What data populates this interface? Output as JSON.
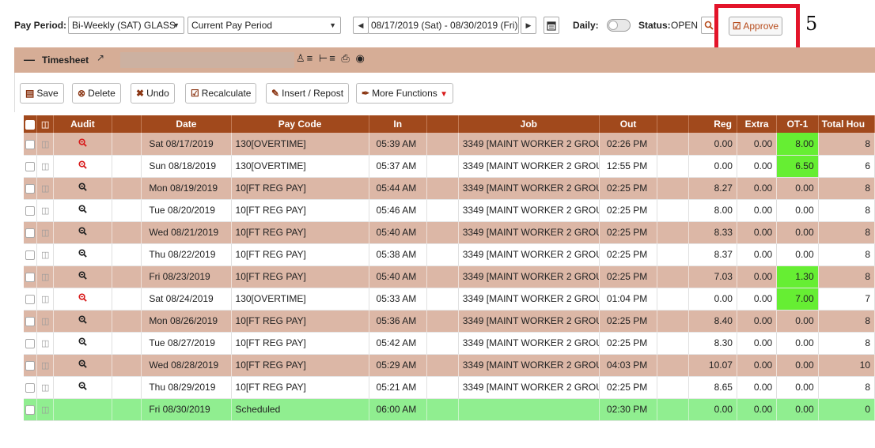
{
  "topbar": {
    "pay_period_label": "Pay Period:",
    "pay_period_value": "Bi-Weekly (SAT) GLASS",
    "period_select_value": "Current Pay Period",
    "date_range": "08/17/2019 (Sat) - 08/30/2019 (Fri)",
    "daily_label": "Daily:",
    "status_label": "Status:",
    "status_value": "OPEN",
    "approve_label": "Approve",
    "step_number": "5"
  },
  "timesheet": {
    "title": "Timesheet"
  },
  "toolbar": {
    "save": "Save",
    "delete": "Delete",
    "undo": "Undo",
    "recalculate": "Recalculate",
    "insert_repost": "Insert / Repost",
    "more_functions": "More Functions"
  },
  "table": {
    "headers": {
      "audit": "Audit",
      "date": "Date",
      "pay_code": "Pay Code",
      "in": "In",
      "job": "Job",
      "out": "Out",
      "reg": "Reg",
      "extra": "Extra",
      "ot1": "OT-1",
      "total_hours": "Total Hou"
    },
    "rows": [
      {
        "date": "Sat 08/17/2019",
        "pay_code": "130[OVERTIME]",
        "in": "05:39 AM",
        "job": "3349 [MAINT WORKER 2 GROU",
        "out": "02:26 PM",
        "reg": "0.00",
        "extra": "0.00",
        "ot1": "8.00",
        "total": "8"
      },
      {
        "date": "Sun 08/18/2019",
        "pay_code": "130[OVERTIME]",
        "in": "05:37 AM",
        "job": "3349 [MAINT WORKER 2 GROU",
        "out": "12:55 PM",
        "reg": "0.00",
        "extra": "0.00",
        "ot1": "6.50",
        "total": "6"
      },
      {
        "date": "Mon 08/19/2019",
        "pay_code": "10[FT REG PAY]",
        "in": "05:44 AM",
        "job": "3349 [MAINT WORKER 2 GROU",
        "out": "02:25 PM",
        "reg": "8.27",
        "extra": "0.00",
        "ot1": "0.00",
        "total": "8"
      },
      {
        "date": "Tue 08/20/2019",
        "pay_code": "10[FT REG PAY]",
        "in": "05:46 AM",
        "job": "3349 [MAINT WORKER 2 GROU",
        "out": "02:25 PM",
        "reg": "8.00",
        "extra": "0.00",
        "ot1": "0.00",
        "total": "8"
      },
      {
        "date": "Wed 08/21/2019",
        "pay_code": "10[FT REG PAY]",
        "in": "05:40 AM",
        "job": "3349 [MAINT WORKER 2 GROU",
        "out": "02:25 PM",
        "reg": "8.33",
        "extra": "0.00",
        "ot1": "0.00",
        "total": "8"
      },
      {
        "date": "Thu 08/22/2019",
        "pay_code": "10[FT REG PAY]",
        "in": "05:38 AM",
        "job": "3349 [MAINT WORKER 2 GROU",
        "out": "02:25 PM",
        "reg": "8.37",
        "extra": "0.00",
        "ot1": "0.00",
        "total": "8"
      },
      {
        "date": "Fri 08/23/2019",
        "pay_code": "10[FT REG PAY]",
        "in": "05:40 AM",
        "job": "3349 [MAINT WORKER 2 GROU",
        "out": "02:25 PM",
        "reg": "7.03",
        "extra": "0.00",
        "ot1": "1.30",
        "total": "8"
      },
      {
        "date": "Sat 08/24/2019",
        "pay_code": "130[OVERTIME]",
        "in": "05:33 AM",
        "job": "3349 [MAINT WORKER 2 GROU",
        "out": "01:04 PM",
        "reg": "0.00",
        "extra": "0.00",
        "ot1": "7.00",
        "total": "7"
      },
      {
        "date": "Mon 08/26/2019",
        "pay_code": "10[FT REG PAY]",
        "in": "05:36 AM",
        "job": "3349 [MAINT WORKER 2 GROU",
        "out": "02:25 PM",
        "reg": "8.40",
        "extra": "0.00",
        "ot1": "0.00",
        "total": "8"
      },
      {
        "date": "Tue 08/27/2019",
        "pay_code": "10[FT REG PAY]",
        "in": "05:42 AM",
        "job": "3349 [MAINT WORKER 2 GROU",
        "out": "02:25 PM",
        "reg": "8.30",
        "extra": "0.00",
        "ot1": "0.00",
        "total": "8"
      },
      {
        "date": "Wed 08/28/2019",
        "pay_code": "10[FT REG PAY]",
        "in": "05:29 AM",
        "job": "3349 [MAINT WORKER 2 GROU",
        "out": "04:03 PM",
        "reg": "10.07",
        "extra": "0.00",
        "ot1": "0.00",
        "total": "10"
      },
      {
        "date": "Thu 08/29/2019",
        "pay_code": "10[FT REG PAY]",
        "in": "05:21 AM",
        "job": "3349 [MAINT WORKER 2 GROU",
        "out": "02:25 PM",
        "reg": "8.65",
        "extra": "0.00",
        "ot1": "0.00",
        "total": "8"
      },
      {
        "date": "Fri 08/30/2019",
        "pay_code": "Scheduled",
        "in": "06:00 AM",
        "job": "",
        "out": "02:30 PM",
        "reg": "0.00",
        "extra": "0.00",
        "ot1": "0.00",
        "total": "0"
      }
    ]
  },
  "colors": {
    "header_bg": "#a1491c",
    "alt_row": "#dcb7a6",
    "scheduled_row": "#90ee90",
    "ot_highlight": "#66ee33",
    "approve_text": "#b64a1a",
    "annotation_red": "#e3142a"
  },
  "icons": {
    "search": "search-icon",
    "audit": "magnifier-zoom-icon",
    "doc": "document-icon"
  }
}
